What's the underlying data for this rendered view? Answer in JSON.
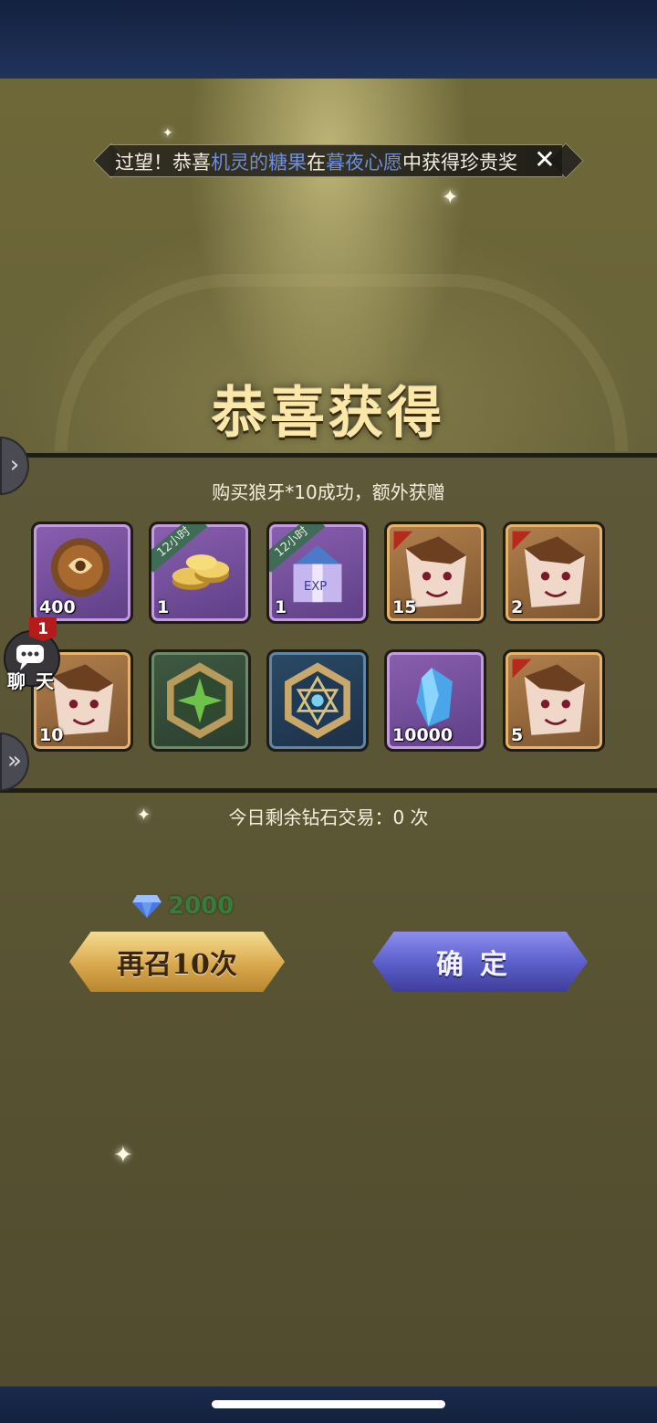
{
  "ticker": {
    "prefix": "过望！恭喜",
    "player": "机灵的糖果",
    "middle": "在",
    "event": "暮夜心愿",
    "suffix": "中获得珍贵奖",
    "close_icon": "close-x-icon"
  },
  "title": "恭喜获得",
  "subtitle": "购买狼牙*10成功，额外获赠",
  "items": [
    {
      "qty": "400",
      "ribbon": "",
      "icon": "bronze-orb-icon",
      "frame": "purple"
    },
    {
      "qty": "1",
      "ribbon": "12小时",
      "icon": "gold-coins-icon",
      "frame": "purple"
    },
    {
      "qty": "1",
      "ribbon": "12小时",
      "icon": "exp-gift-box-icon",
      "frame": "purple"
    },
    {
      "qty": "15",
      "ribbon": "",
      "icon": "hero-fragment-icon",
      "frame": "brown"
    },
    {
      "qty": "2",
      "ribbon": "",
      "icon": "hero-fragment-icon",
      "frame": "brown"
    },
    {
      "qty": "10",
      "ribbon": "",
      "icon": "hero-fragment-icon",
      "frame": "brown"
    },
    {
      "qty": "",
      "ribbon": "",
      "icon": "green-emblem-icon",
      "frame": "green"
    },
    {
      "qty": "",
      "ribbon": "",
      "icon": "blue-star-emblem-icon",
      "frame": "blue"
    },
    {
      "qty": "10000",
      "ribbon": "",
      "icon": "blue-crystal-icon",
      "frame": "purple"
    },
    {
      "qty": "5",
      "ribbon": "",
      "icon": "hero-fragment-icon",
      "frame": "brown"
    }
  ],
  "chat": {
    "label": "聊 天",
    "badge": "1"
  },
  "remaining": "今日剩余钻石交易：0 次",
  "cost": {
    "icon": "diamond-icon",
    "value": "2000"
  },
  "buttons": {
    "again": "再召10次",
    "confirm": "确定"
  },
  "colors": {
    "accent_gold": "#d9a94e",
    "accent_purple": "#5a5cc8",
    "cost_green": "#3a7a3a",
    "ticker_highlight": "#6f8fd8"
  }
}
